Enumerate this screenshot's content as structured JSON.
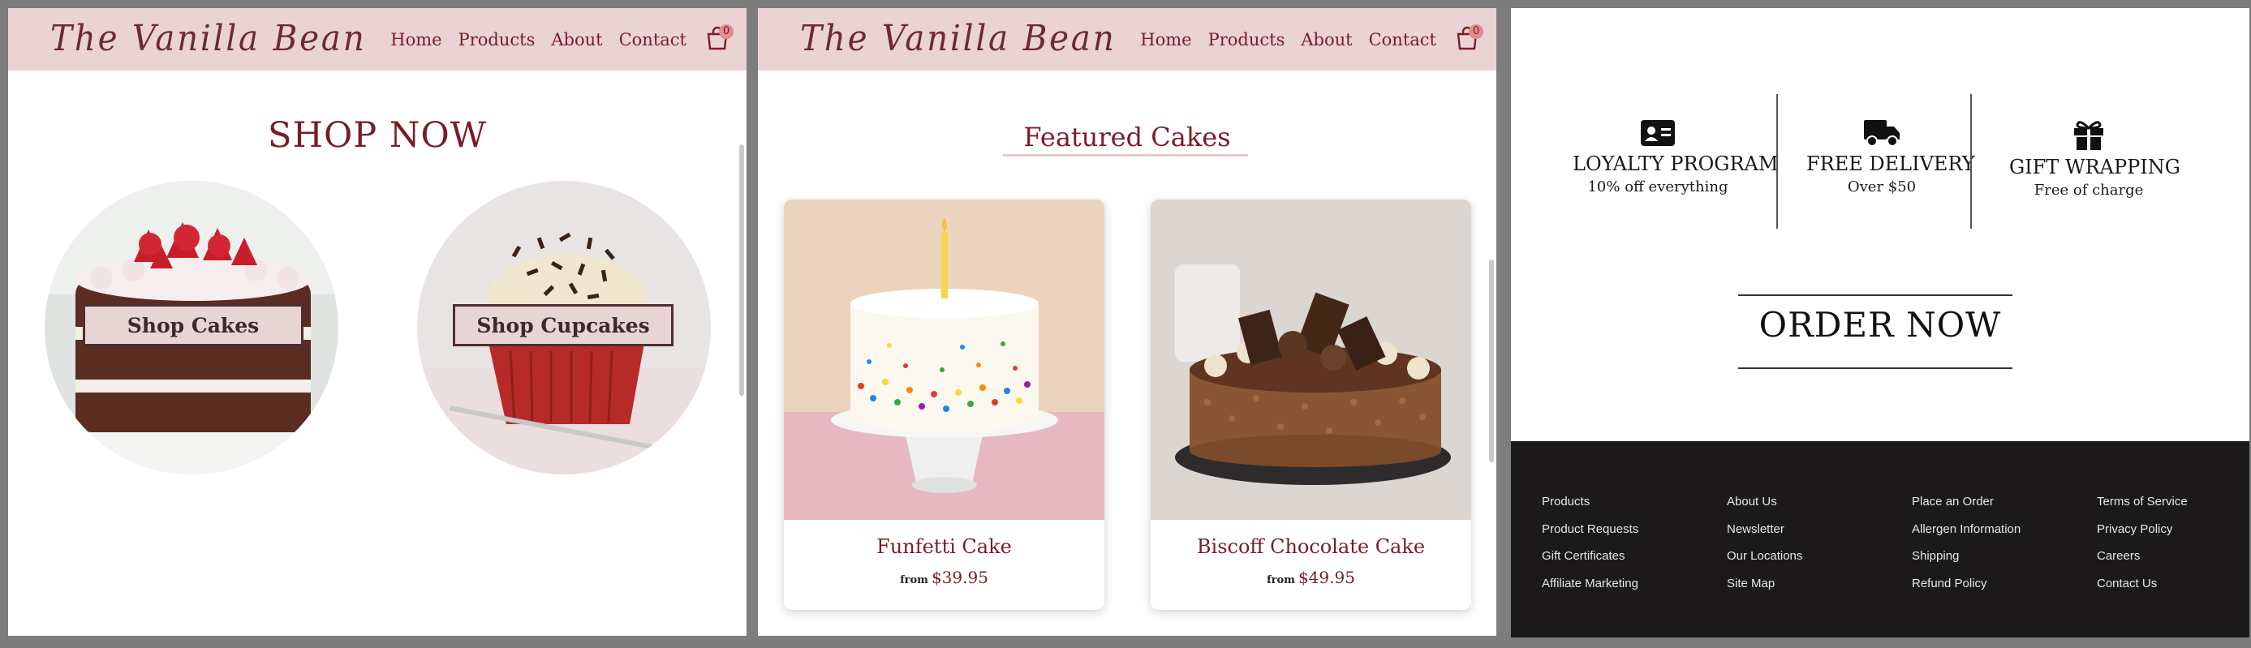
{
  "brand": {
    "logo": "The Vanilla Bean"
  },
  "nav": {
    "items": [
      "Home",
      "Products",
      "About",
      "Contact"
    ],
    "cart_count": "0"
  },
  "shop": {
    "title": "SHOP NOW",
    "cakes_button": "Shop Cakes",
    "cupcakes_button": "Shop Cupcakes"
  },
  "featured": {
    "title": "Featured Cakes",
    "cards": [
      {
        "name": "Funfetti Cake",
        "from": "from",
        "price": "$39.95"
      },
      {
        "name": "Biscoff Chocolate Cake",
        "from": "from",
        "price": "$49.95"
      }
    ]
  },
  "features": [
    {
      "title": "LOYALTY PROGRAM",
      "subtitle": "10% off everything",
      "icon": "id-card-icon"
    },
    {
      "title": "FREE DELIVERY",
      "subtitle": "Over $50",
      "icon": "truck-icon"
    },
    {
      "title": "GIFT WRAPPING",
      "subtitle": "Free of charge",
      "icon": "gift-icon"
    }
  ],
  "order": {
    "label": "ORDER NOW"
  },
  "footer": {
    "columns": [
      [
        "Products",
        "Product Requests",
        "Gift Certificates",
        "Affiliate Marketing"
      ],
      [
        "About Us",
        "Newsletter",
        "Our Locations",
        "Site Map"
      ],
      [
        "Place an Order",
        "Allergen Information",
        "Shipping",
        "Refund Policy"
      ],
      [
        "Terms of Service",
        "Privacy Policy",
        "Careers",
        "Contact Us"
      ]
    ]
  },
  "colors": {
    "nav_bg": "#ead3d5",
    "accent": "#7a1c26",
    "footer_bg": "#1b191a",
    "page_bg": "#7d7d7d"
  }
}
